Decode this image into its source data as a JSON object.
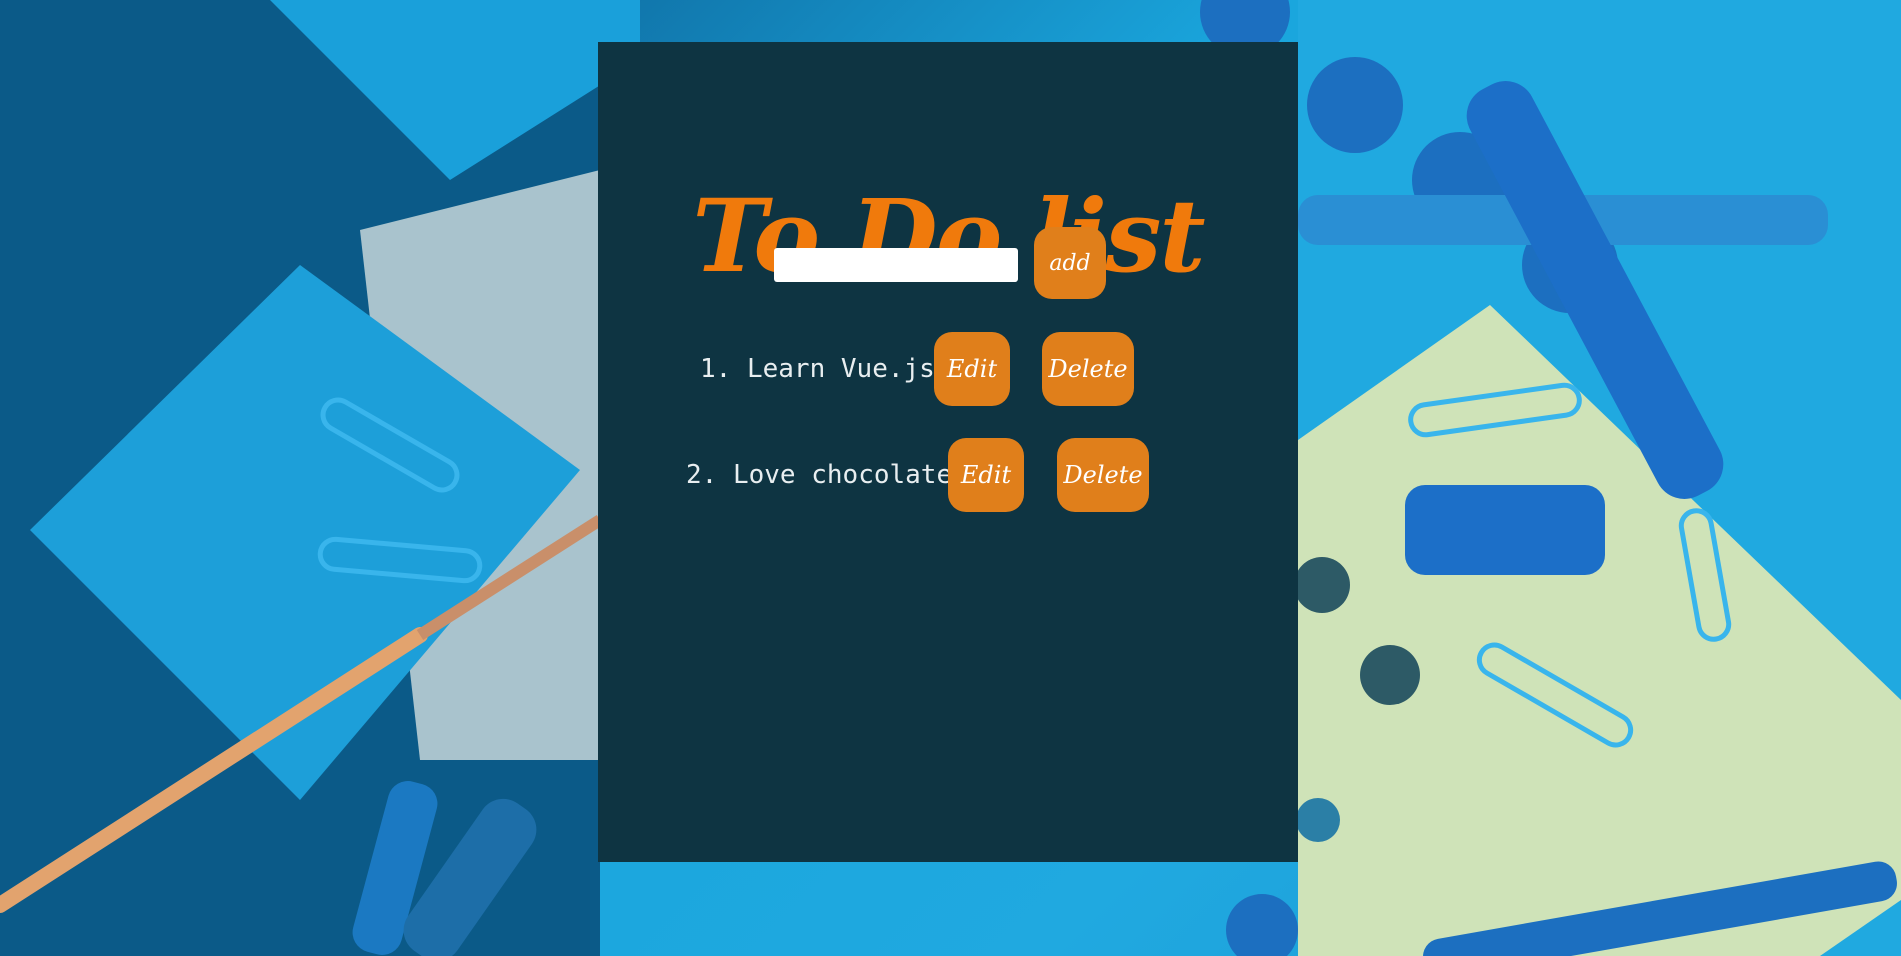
{
  "app": {
    "title": "To Do list"
  },
  "add_form": {
    "input_value": "",
    "input_placeholder": "",
    "add_label": "add"
  },
  "todos": [
    {
      "index": "1.",
      "text": "Learn Vue.js",
      "edit_label": "Edit",
      "delete_label": "Delete"
    },
    {
      "index": "2.",
      "text": "Love chocolate",
      "edit_label": "Edit",
      "delete_label": "Delete"
    }
  ],
  "colors": {
    "panel_background": "#0e3442",
    "title": "#f07a0c",
    "button": "#e07f1b",
    "button_text": "#ffffff",
    "item_text": "#e8eef0",
    "page_background": "#1f9fd6"
  }
}
